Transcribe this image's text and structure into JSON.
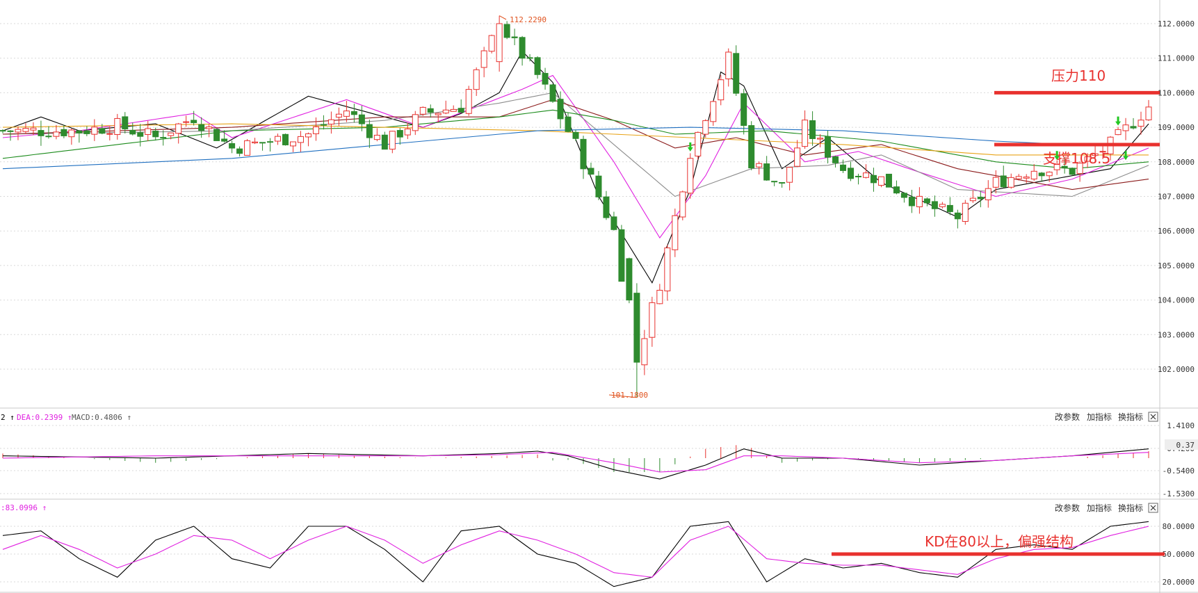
{
  "toolbar": {
    "change_params": "改参数",
    "add_indicator": "加指标",
    "swap_indicator": "换指标",
    "close_icon": "close-icon"
  },
  "colors": {
    "up": "#e8312e",
    "down": "#2e8b2e",
    "annotation": "#e8312e",
    "grid": "#d9d9d9",
    "ext_label": "#e0531f",
    "macd_dif": "#000000",
    "macd_dea": "#e020e0",
    "kd_k": "#000000",
    "kd_d": "#e020e0",
    "ma": [
      "#000000",
      "#e020e0",
      "#8c8c8c",
      "#8b1a1a",
      "#1a8a1a",
      "#e8a317",
      "#1f6fc0"
    ]
  },
  "chart_data": [
    {
      "type": "candlestick",
      "name": "price",
      "ylim": [
        101.18,
        112.3
      ],
      "yticks": [
        "112.0000",
        "111.0000",
        "110.0000",
        "109.0000",
        "108.0000",
        "107.0000",
        "106.0000",
        "105.0000",
        "104.0000",
        "103.0000",
        "102.0000"
      ],
      "high_label": "112.2290",
      "low_label": "101.1800",
      "annotations": [
        {
          "text": "压力110",
          "level": 110.0
        },
        {
          "text": "支撑108.5",
          "level": 108.5
        }
      ],
      "anchors": [
        [
          0,
          108.9
        ],
        [
          10,
          108.9
        ],
        [
          15,
          109.05
        ],
        [
          20,
          108.7
        ],
        [
          25,
          109.3
        ],
        [
          30,
          108.4
        ],
        [
          35,
          108.6
        ],
        [
          40,
          108.8
        ],
        [
          45,
          109.5
        ],
        [
          50,
          108.5
        ],
        [
          55,
          109.4
        ],
        [
          60,
          109.6
        ],
        [
          65,
          112.0
        ],
        [
          70,
          110.5
        ],
        [
          75,
          108.5
        ],
        [
          80,
          106.0
        ],
        [
          83,
          102.3
        ],
        [
          86,
          104.5
        ],
        [
          90,
          108.3
        ],
        [
          95,
          111.0
        ],
        [
          98,
          108.0
        ],
        [
          102,
          107.3
        ],
        [
          105,
          109.0
        ],
        [
          110,
          107.8
        ],
        [
          115,
          107.5
        ],
        [
          120,
          106.8
        ],
        [
          125,
          106.4
        ],
        [
          130,
          107.4
        ],
        [
          135,
          107.8
        ],
        [
          140,
          107.75
        ],
        [
          145,
          108.5
        ],
        [
          150,
          109.6
        ]
      ],
      "ma_lines": [
        {
          "name": "MA5",
          "points": [
            [
              0,
              108.9
            ],
            [
              5,
              109.3
            ],
            [
              10,
              108.9
            ],
            [
              20,
              109.1
            ],
            [
              28,
              108.4
            ],
            [
              40,
              109.9
            ],
            [
              55,
              109.0
            ],
            [
              60,
              109.4
            ],
            [
              65,
              110.0
            ],
            [
              68,
              111.2
            ],
            [
              72,
              110.3
            ],
            [
              78,
              107.0
            ],
            [
              85,
              104.5
            ],
            [
              90,
              107.2
            ],
            [
              94,
              110.6
            ],
            [
              97,
              110.2
            ],
            [
              102,
              107.8
            ],
            [
              108,
              108.7
            ],
            [
              115,
              107.4
            ],
            [
              125,
              106.4
            ],
            [
              130,
              107.2
            ],
            [
              140,
              107.6
            ],
            [
              145,
              107.8
            ],
            [
              150,
              109.1
            ]
          ]
        },
        {
          "name": "MA10",
          "points": [
            [
              0,
              108.7
            ],
            [
              10,
              108.9
            ],
            [
              25,
              109.4
            ],
            [
              30,
              108.7
            ],
            [
              45,
              109.8
            ],
            [
              55,
              109.0
            ],
            [
              68,
              110.1
            ],
            [
              72,
              110.5
            ],
            [
              80,
              108.0
            ],
            [
              86,
              105.8
            ],
            [
              92,
              107.6
            ],
            [
              97,
              109.7
            ],
            [
              105,
              108.0
            ],
            [
              112,
              108.3
            ],
            [
              120,
              107.7
            ],
            [
              130,
              107.0
            ],
            [
              140,
              107.5
            ],
            [
              150,
              108.4
            ]
          ]
        },
        {
          "name": "MA20",
          "points": [
            [
              0,
              108.8
            ],
            [
              30,
              108.9
            ],
            [
              50,
              109.2
            ],
            [
              65,
              109.7
            ],
            [
              72,
              110.0
            ],
            [
              80,
              108.5
            ],
            [
              88,
              107.0
            ],
            [
              98,
              107.8
            ],
            [
              108,
              107.9
            ],
            [
              115,
              108.2
            ],
            [
              125,
              107.2
            ],
            [
              140,
              107.0
            ],
            [
              150,
              107.9
            ]
          ]
        },
        {
          "name": "MA30",
          "points": [
            [
              0,
              108.8
            ],
            [
              30,
              109.0
            ],
            [
              50,
              109.3
            ],
            [
              65,
              109.3
            ],
            [
              72,
              109.8
            ],
            [
              80,
              109.2
            ],
            [
              88,
              108.4
            ],
            [
              96,
              108.7
            ],
            [
              105,
              108.2
            ],
            [
              115,
              108.5
            ],
            [
              125,
              107.8
            ],
            [
              140,
              107.2
            ],
            [
              150,
              107.5
            ]
          ]
        },
        {
          "name": "MA60",
          "points": [
            [
              0,
              108.1
            ],
            [
              30,
              108.9
            ],
            [
              50,
              109.0
            ],
            [
              65,
              109.3
            ],
            [
              72,
              109.5
            ],
            [
              80,
              109.2
            ],
            [
              88,
              108.8
            ],
            [
              100,
              108.9
            ],
            [
              115,
              108.6
            ],
            [
              130,
              108.0
            ],
            [
              140,
              107.8
            ],
            [
              150,
              108.0
            ]
          ]
        },
        {
          "name": "MA120",
          "points": [
            [
              0,
              109.0
            ],
            [
              30,
              109.1
            ],
            [
              50,
              109.0
            ],
            [
              70,
              108.9
            ],
            [
              90,
              108.7
            ],
            [
              110,
              108.5
            ],
            [
              130,
              108.2
            ],
            [
              150,
              108.2
            ]
          ]
        },
        {
          "name": "MA250",
          "points": [
            [
              0,
              107.8
            ],
            [
              30,
              108.1
            ],
            [
              50,
              108.5
            ],
            [
              70,
              108.9
            ],
            [
              90,
              109.0
            ],
            [
              110,
              108.9
            ],
            [
              130,
              108.6
            ],
            [
              140,
              108.5
            ]
          ]
        }
      ]
    },
    {
      "type": "macd",
      "name": "MACD",
      "header": {
        "prefix": "2 ↑",
        "dea_label": "DEA:0.2399 ↑",
        "macd_label": "MACD:0.4806 ↑"
      },
      "yticks": [
        "1.4100",
        "0.4200",
        "-0.5400",
        "-1.5300"
      ],
      "current_value": "0.37",
      "ylim": [
        -1.7,
        1.6
      ],
      "dif": [
        [
          0,
          0.1
        ],
        [
          20,
          0.0
        ],
        [
          40,
          0.2
        ],
        [
          55,
          0.1
        ],
        [
          65,
          0.2
        ],
        [
          70,
          0.3
        ],
        [
          74,
          0.1
        ],
        [
          80,
          -0.5
        ],
        [
          86,
          -0.9
        ],
        [
          92,
          -0.3
        ],
        [
          97,
          0.4
        ],
        [
          102,
          0.0
        ],
        [
          110,
          0.0
        ],
        [
          120,
          -0.3
        ],
        [
          130,
          -0.1
        ],
        [
          140,
          0.1
        ],
        [
          150,
          0.4
        ]
      ],
      "dea": [
        [
          0,
          0.0
        ],
        [
          20,
          0.1
        ],
        [
          40,
          0.1
        ],
        [
          55,
          0.1
        ],
        [
          65,
          0.15
        ],
        [
          72,
          0.25
        ],
        [
          80,
          -0.2
        ],
        [
          86,
          -0.6
        ],
        [
          92,
          -0.5
        ],
        [
          97,
          0.1
        ],
        [
          102,
          0.1
        ],
        [
          110,
          0.0
        ],
        [
          120,
          -0.2
        ],
        [
          130,
          -0.1
        ],
        [
          140,
          0.1
        ],
        [
          150,
          0.25
        ]
      ]
    },
    {
      "type": "kd",
      "name": "KD",
      "header": {
        "label": ":83.0996 ↑"
      },
      "yticks": [
        "80.0000",
        "50.0000",
        "20.0000"
      ],
      "ylim": [
        10,
        100
      ],
      "annotation": {
        "text": "KD在80以上，偏强结构",
        "level": 50
      },
      "k": [
        [
          0,
          70
        ],
        [
          5,
          75
        ],
        [
          10,
          45
        ],
        [
          15,
          25
        ],
        [
          20,
          65
        ],
        [
          25,
          80
        ],
        [
          30,
          45
        ],
        [
          35,
          35
        ],
        [
          40,
          80
        ],
        [
          45,
          80
        ],
        [
          50,
          55
        ],
        [
          55,
          20
        ],
        [
          60,
          75
        ],
        [
          65,
          80
        ],
        [
          70,
          50
        ],
        [
          75,
          40
        ],
        [
          80,
          15
        ],
        [
          85,
          25
        ],
        [
          90,
          80
        ],
        [
          95,
          85
        ],
        [
          100,
          20
        ],
        [
          105,
          45
        ],
        [
          110,
          35
        ],
        [
          115,
          40
        ],
        [
          120,
          30
        ],
        [
          125,
          25
        ],
        [
          130,
          55
        ],
        [
          135,
          60
        ],
        [
          140,
          55
        ],
        [
          145,
          80
        ],
        [
          150,
          85
        ]
      ],
      "d": [
        [
          0,
          55
        ],
        [
          5,
          70
        ],
        [
          10,
          55
        ],
        [
          15,
          35
        ],
        [
          20,
          50
        ],
        [
          25,
          70
        ],
        [
          30,
          65
        ],
        [
          35,
          45
        ],
        [
          40,
          65
        ],
        [
          45,
          80
        ],
        [
          50,
          65
        ],
        [
          55,
          40
        ],
        [
          60,
          60
        ],
        [
          65,
          75
        ],
        [
          70,
          65
        ],
        [
          75,
          50
        ],
        [
          80,
          30
        ],
        [
          85,
          25
        ],
        [
          90,
          65
        ],
        [
          95,
          80
        ],
        [
          100,
          45
        ],
        [
          105,
          40
        ],
        [
          110,
          38
        ],
        [
          115,
          38
        ],
        [
          120,
          33
        ],
        [
          125,
          28
        ],
        [
          130,
          45
        ],
        [
          135,
          55
        ],
        [
          140,
          57
        ],
        [
          145,
          70
        ],
        [
          150,
          80
        ]
      ]
    }
  ]
}
